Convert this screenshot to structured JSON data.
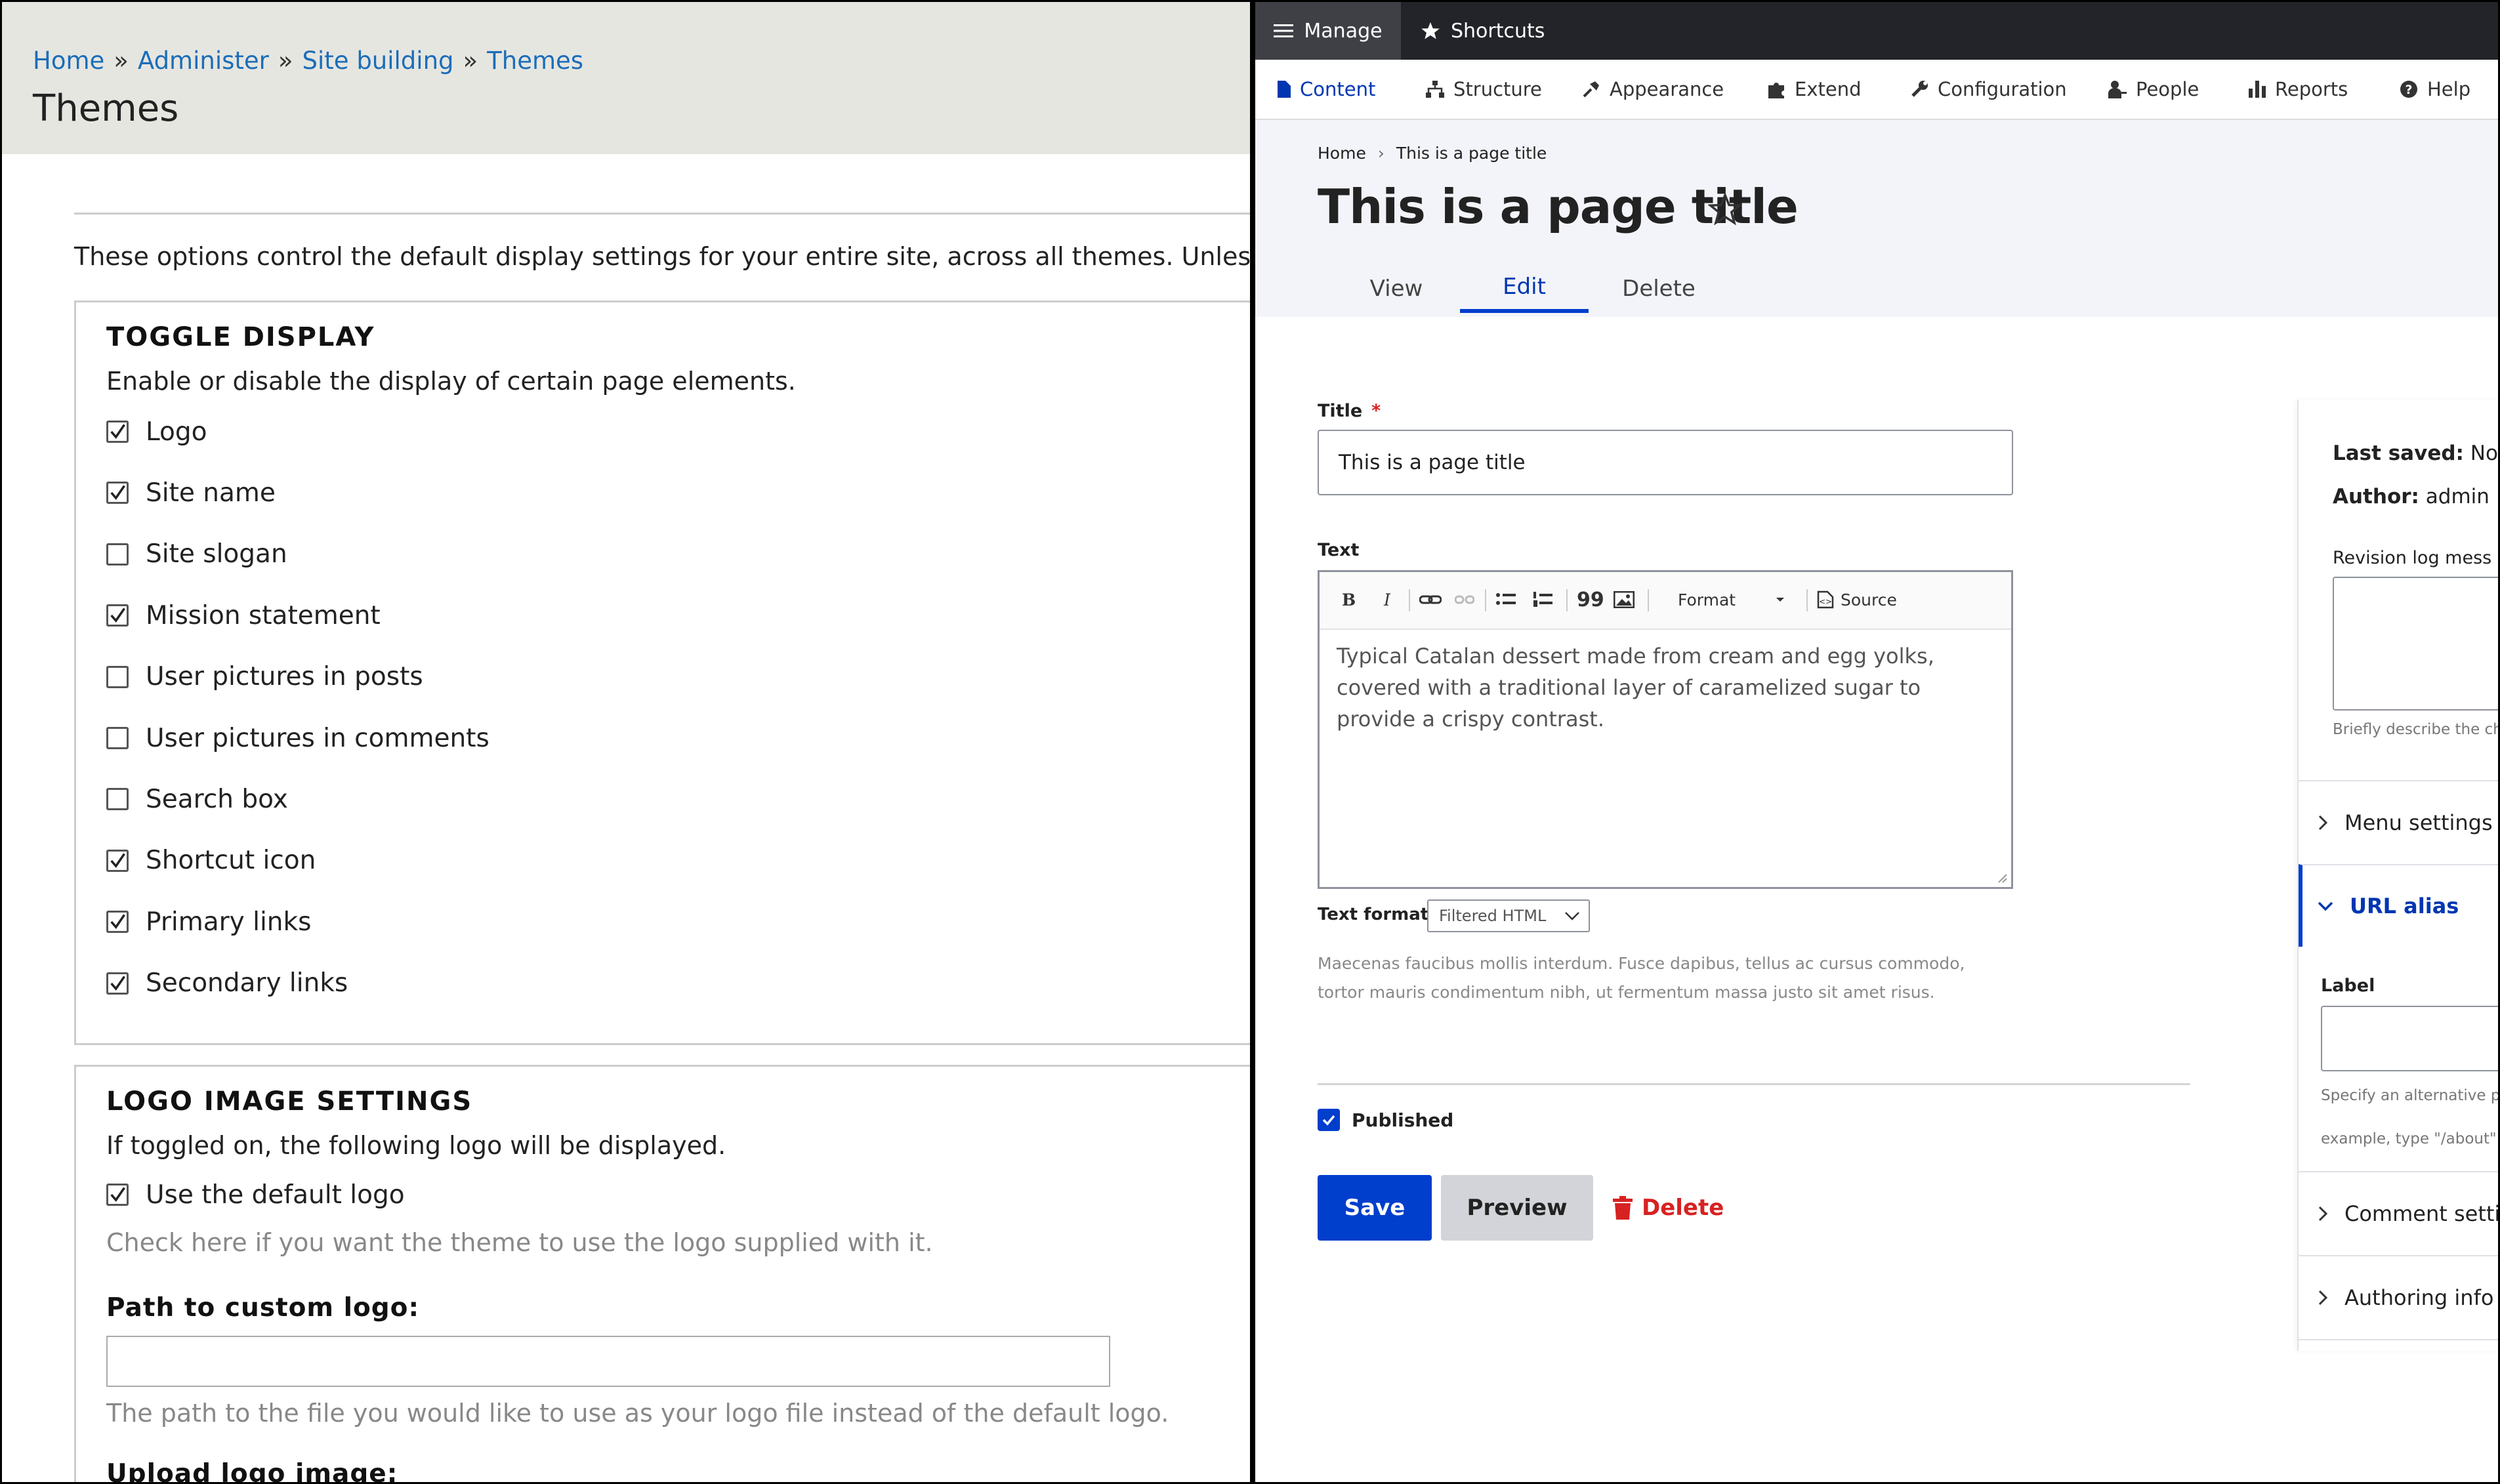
{
  "left": {
    "breadcrumb": [
      "Home",
      "Administer",
      "Site building",
      "Themes"
    ],
    "breadcrumb_sep": "»",
    "title": "Themes",
    "intro": "These options control the default display settings for your entire site, across all themes. Unless",
    "toggle_display": {
      "legend": "TOGGLE DISPLAY",
      "description": "Enable or disable the display of certain page elements.",
      "items": [
        {
          "label": "Logo",
          "checked": true
        },
        {
          "label": "Site name",
          "checked": true
        },
        {
          "label": "Site slogan",
          "checked": false
        },
        {
          "label": "Mission statement",
          "checked": true
        },
        {
          "label": "User pictures in posts",
          "checked": false
        },
        {
          "label": "User pictures in comments",
          "checked": false
        },
        {
          "label": "Search box",
          "checked": false
        },
        {
          "label": "Shortcut icon",
          "checked": true
        },
        {
          "label": "Primary links",
          "checked": true
        },
        {
          "label": "Secondary links",
          "checked": true
        }
      ]
    },
    "logo_settings": {
      "legend": "LOGO IMAGE SETTINGS",
      "description": "If toggled on, the following logo will be displayed.",
      "use_default_label": "Use the default logo",
      "use_default_checked": true,
      "use_default_help": "Check here if you want the theme to use the logo supplied with it.",
      "path_label": "Path to custom logo:",
      "path_value": "",
      "path_help": "The path to the file you would like to use as your logo file instead of the default logo.",
      "upload_label": "Upload logo image:"
    }
  },
  "right": {
    "toolbar": {
      "manage": "Manage",
      "shortcuts": "Shortcuts"
    },
    "tray": [
      "Content",
      "Structure",
      "Appearance",
      "Extend",
      "Configuration",
      "People",
      "Reports",
      "Help"
    ],
    "tray_active": "Content",
    "breadcrumb": [
      "Home",
      "This is a page title"
    ],
    "breadcrumb_sep": "›",
    "page_title": "This is a page title",
    "tabs": [
      "View",
      "Edit",
      "Delete"
    ],
    "active_tab": "Edit",
    "form": {
      "title_label": "Title",
      "required_mark": "*",
      "title_value": "This is a page title",
      "text_label": "Text",
      "editor_buttons": {
        "bold": "B",
        "italic": "I",
        "quote": "99",
        "format": "Format",
        "source": "Source"
      },
      "body": "Typical Catalan dessert made from cream and egg yolks, covered with a traditional layer of caramelized sugar to provide a crispy contrast.",
      "text_format_label": "Text format",
      "text_format_value": "Filtered HTML",
      "help": "Maecenas faucibus mollis interdum. Fusce dapibus, tellus ac cursus commodo, tortor mauris condimentum nibh, ut fermentum massa justo sit amet risus.",
      "published_label": "Published",
      "published_checked": true,
      "save": "Save",
      "preview": "Preview",
      "delete": "Delete"
    },
    "sidebar": {
      "last_saved_label": "Last saved:",
      "last_saved_value": "Not s",
      "author_label": "Author:",
      "author_value": "admin",
      "revision_label": "Revision log mess",
      "revision_help": "Briefly describe the cha",
      "sections": [
        "Menu settings",
        "URL alias",
        "Comment setti",
        "Authoring info"
      ],
      "open_section": "URL alias",
      "url_label": "Label",
      "url_help_1": "Specify an alternative pa",
      "url_help_2": "example, type \"/about\""
    },
    "colors": {
      "primary": "#003ecc",
      "danger": "#d72222",
      "toolbar": "#232429",
      "link": "#1b6db9"
    }
  }
}
